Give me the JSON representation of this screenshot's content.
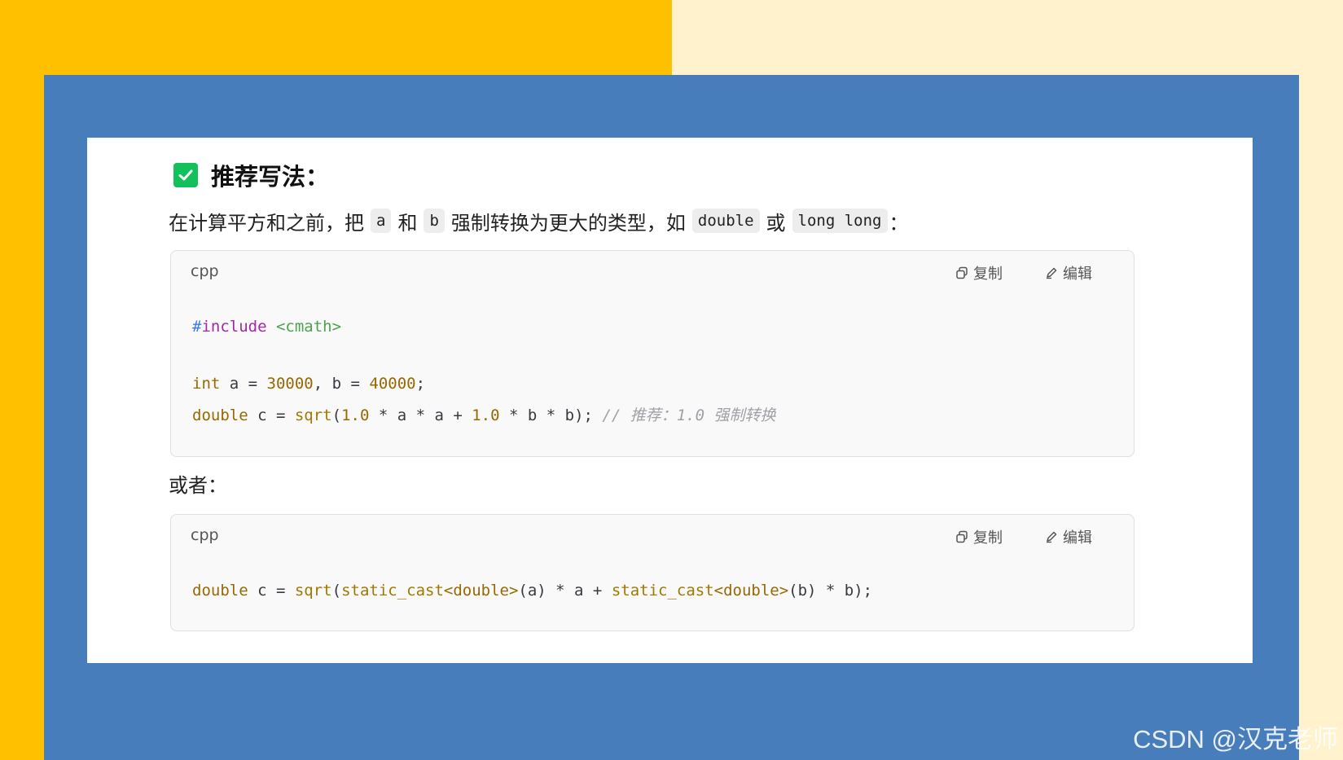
{
  "colors": {
    "left_bg": "#FFC000",
    "right_bg": "#FFF2CC",
    "frame": "#487DBC",
    "check": "#13C15A"
  },
  "heading": {
    "icon": "check-box-icon",
    "text": "推荐写法："
  },
  "para1": {
    "t1": "在计算平方和之前，把",
    "c1": "a",
    "t2": "和",
    "c2": "b",
    "t3": "强制转换为更大的类型，如",
    "c3": "double",
    "t4": "或",
    "c4": "long long",
    "t5": "："
  },
  "block1": {
    "lang": "cpp",
    "copy_label": "复制",
    "edit_label": "编辑",
    "line1": {
      "hash": "#",
      "directive": "include",
      "header": "<cmath>"
    },
    "line2": {
      "type": "int",
      "a": " a = ",
      "n1": "30000",
      "b": ", b = ",
      "n2": "40000",
      "end": ";"
    },
    "line3": {
      "type": "double",
      "p1": " c = ",
      "fn": "sqrt",
      "p2": "(",
      "n1": "1.0",
      "p3": " * a * a + ",
      "n2": "1.0",
      "p4": " * b * b); ",
      "comment": "// 推荐：1.0 强制转换"
    }
  },
  "para2": {
    "text": "或者："
  },
  "block2": {
    "lang": "cpp",
    "copy_label": "复制",
    "edit_label": "编辑",
    "line1": {
      "type": "double",
      "p1": " c = ",
      "fn": "sqrt",
      "p2": "(",
      "cast1": "static_cast",
      "t1": "<double>",
      "p3": "(a) * a + ",
      "cast2": "static_cast",
      "t2": "<double>",
      "p4": "(b) * b);"
    }
  },
  "watermark": "CSDN @汉克老师"
}
